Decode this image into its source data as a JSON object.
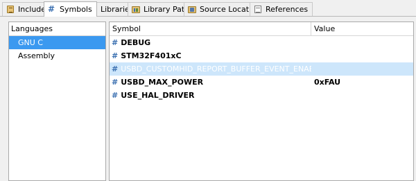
{
  "tabs": [
    {
      "label": "Includes",
      "icon": "includes-icon",
      "active": false
    },
    {
      "label": "Symbols",
      "icon": "hash-icon",
      "active": true
    },
    {
      "label": "Libraries",
      "icon": "libraries-icon",
      "active": false
    },
    {
      "label": "Library Paths",
      "icon": "library-paths-icon",
      "active": false
    },
    {
      "label": "Source Location",
      "icon": "source-location-icon",
      "active": false
    },
    {
      "label": "References",
      "icon": "references-icon",
      "active": false
    }
  ],
  "languages": {
    "header": "Languages",
    "items": [
      "GNU C",
      "Assembly"
    ],
    "selected": "GNU C"
  },
  "symbols": {
    "columns": {
      "symbol": "Symbol",
      "value": "Value"
    },
    "hash_glyph": "#",
    "rows": [
      {
        "symbol": "DEBUG",
        "value": ""
      },
      {
        "symbol": "STM32F401xC",
        "value": ""
      },
      {
        "symbol": "USBD_CUSTOMHID_REPORT_BUFFER_EVENT_ENABLED",
        "value": "",
        "selected": true
      },
      {
        "symbol": "USBD_MAX_POWER",
        "value": "0xFAU"
      },
      {
        "symbol": "USE_HAL_DRIVER",
        "value": ""
      }
    ]
  },
  "colors": {
    "selection_blue": "#3b99f0",
    "row_highlight": "#cde6fb",
    "hash_blue": "#3a6fb0"
  }
}
